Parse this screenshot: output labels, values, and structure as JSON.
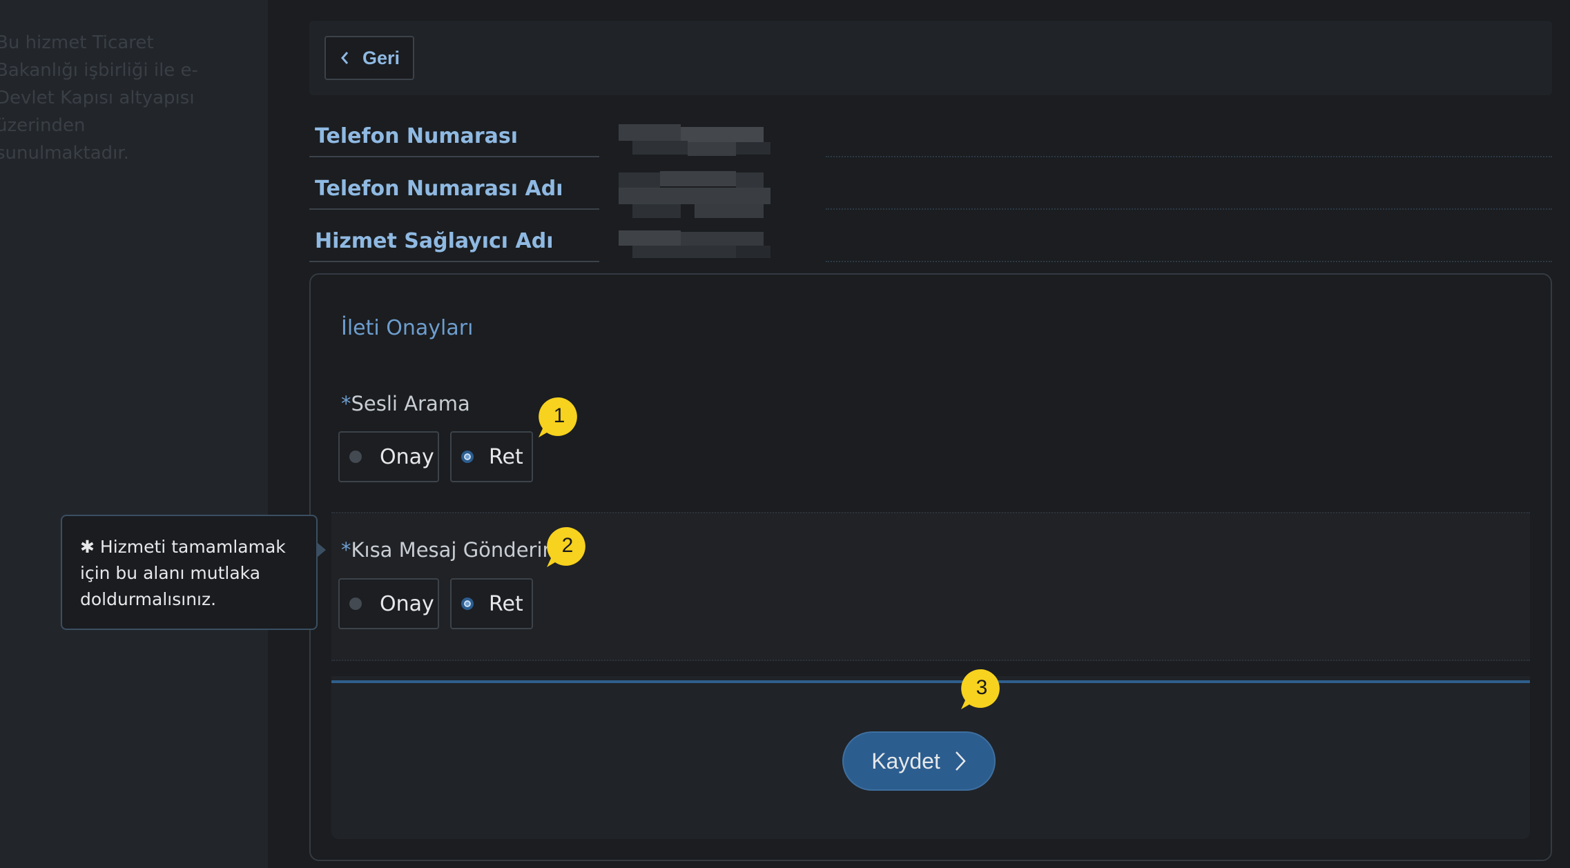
{
  "sidebar": {
    "note": "Bu hizmet Ticaret Bakanlığı işbirliği ile e-Devlet Kapısı altyapısı üzerinden sunulmaktadır."
  },
  "header": {
    "back_label": "Geri"
  },
  "info": {
    "rows": [
      {
        "label": "Telefon Numarası"
      },
      {
        "label": "Telefon Numarası Adı"
      },
      {
        "label": "Hizmet Sağlayıcı Adı"
      }
    ]
  },
  "consent": {
    "title": "İleti Onayları",
    "required_mark": "*",
    "fields": [
      {
        "label": "Sesli Arama",
        "options": [
          {
            "label": "Onay",
            "checked": false
          },
          {
            "label": "Ret",
            "checked": true
          }
        ]
      },
      {
        "label": "Kısa Mesaj Gönderim",
        "options": [
          {
            "label": "Onay",
            "checked": false
          },
          {
            "label": "Ret",
            "checked": true
          }
        ]
      }
    ],
    "save_label": "Kaydet"
  },
  "tooltip": {
    "star": "✱",
    "text": "Hizmeti tamamlamak için bu alanı mutlaka doldurmalısınız."
  },
  "callouts": [
    "1",
    "2",
    "3"
  ],
  "colors": {
    "accent": "#8fb9e2",
    "primary_button": "#2c5d8f",
    "callout": "#f7d21e",
    "background": "#1b1d20"
  }
}
